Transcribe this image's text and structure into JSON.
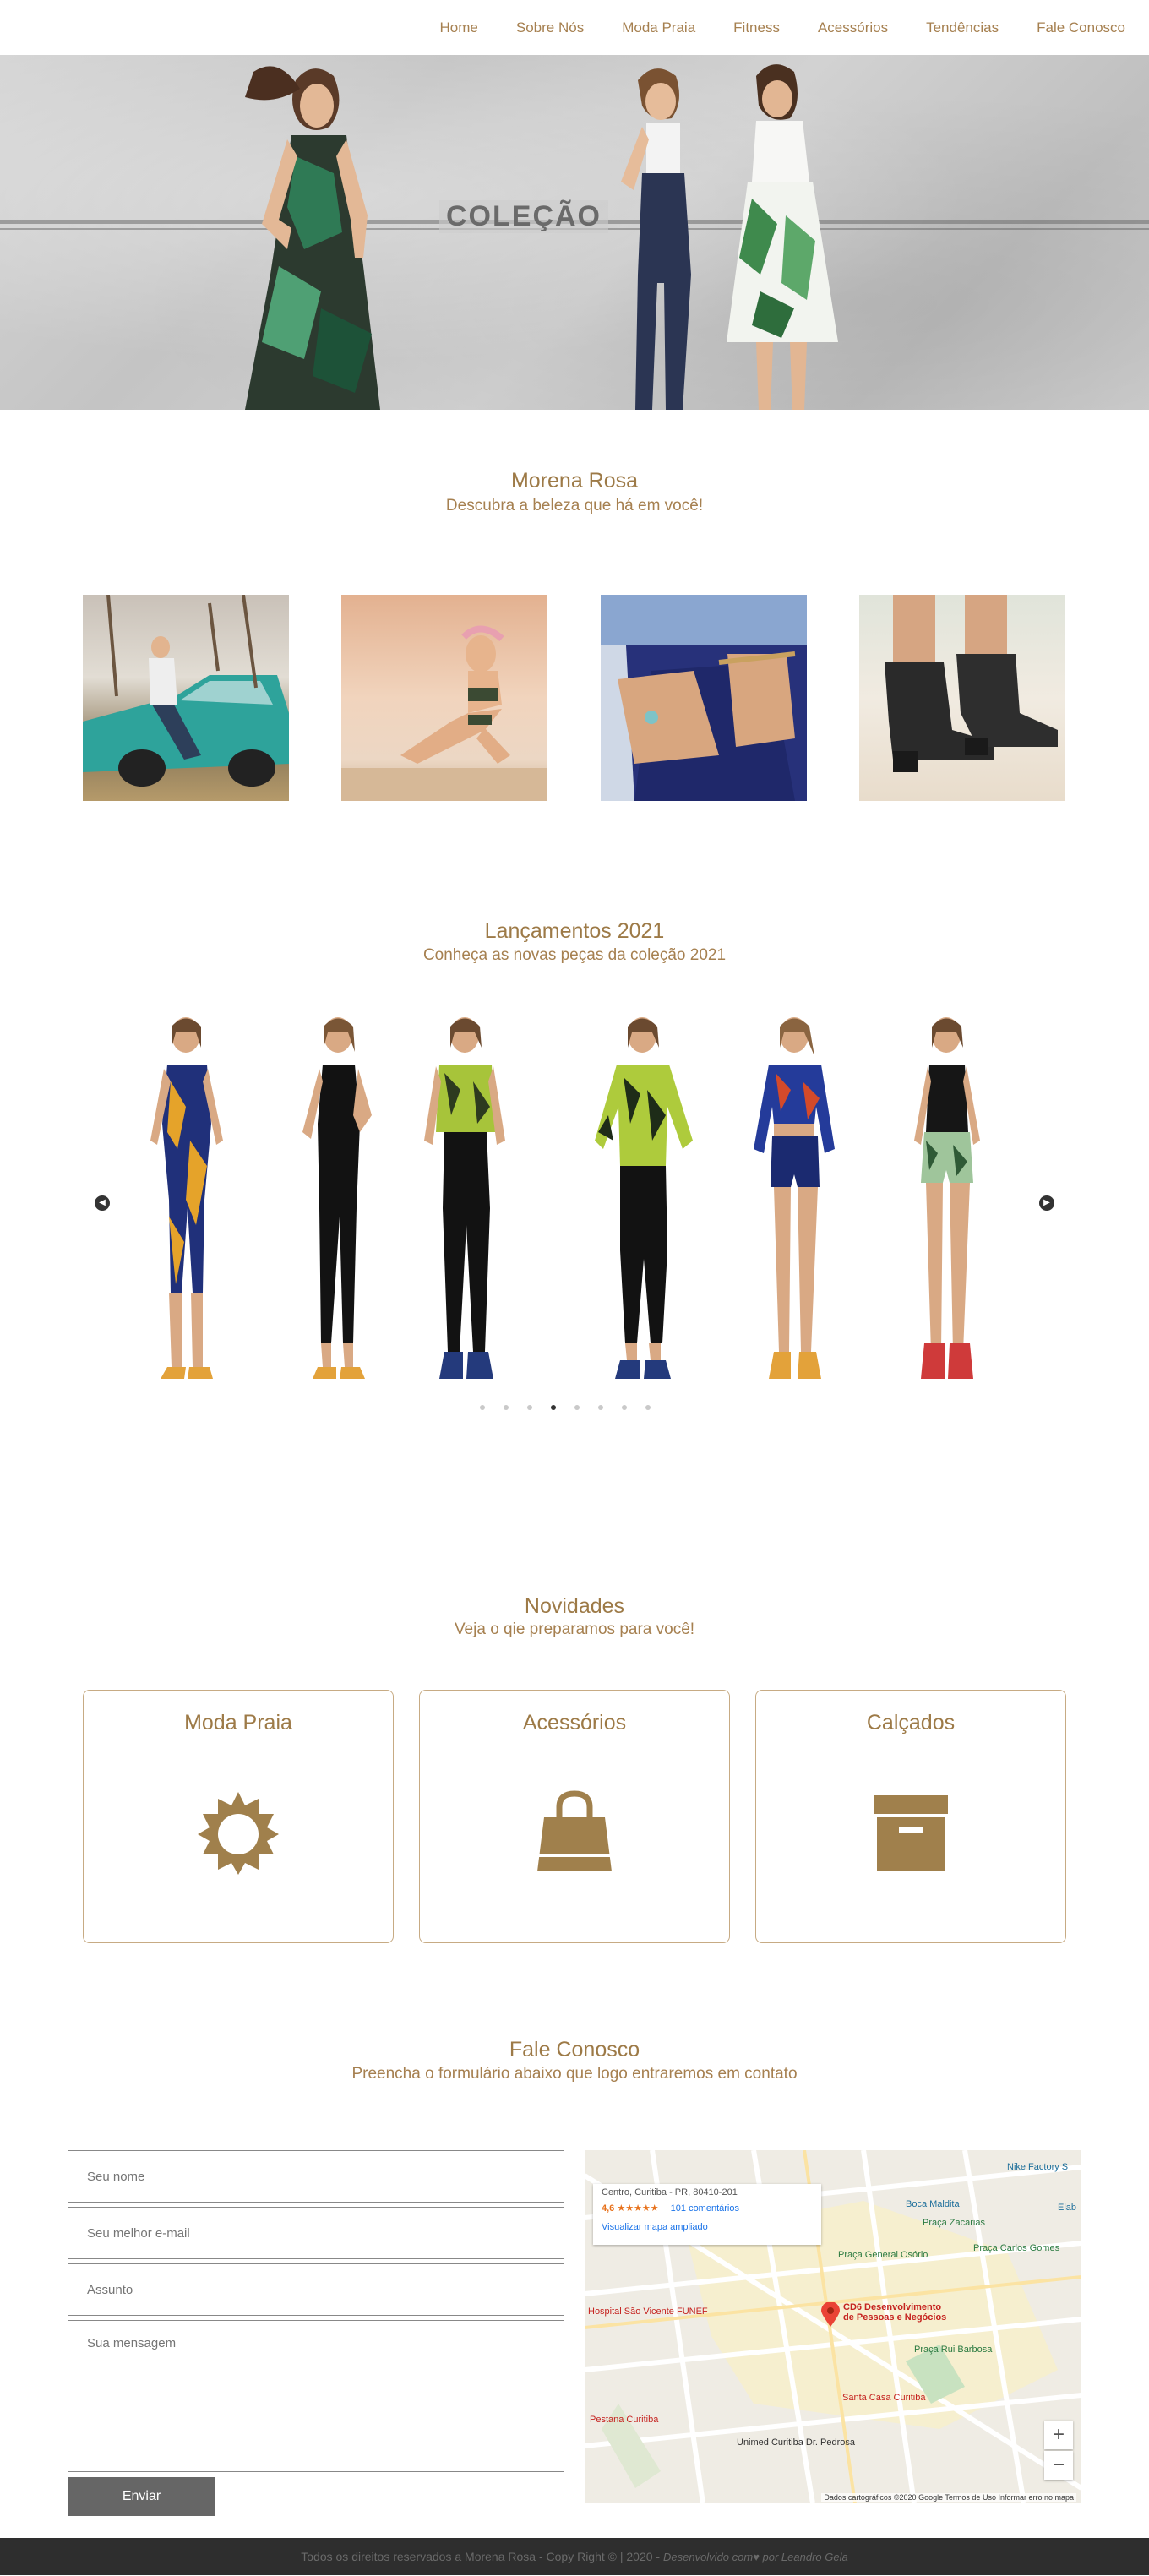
{
  "nav": [
    "Home",
    "Sobre Nós",
    "Moda Praia",
    "Fitness",
    "Acessórios",
    "Tendências",
    "Fale Conosco"
  ],
  "hero": {
    "title": "COLEÇÃO"
  },
  "intro": {
    "title": "Morena Rosa",
    "subtitle": "Descubra a beleza que há em você!"
  },
  "launches": {
    "title": "Lançamentos 2021",
    "subtitle": "Conheça as novas peças da coleção 2021",
    "prev": "◀",
    "next": "▶",
    "active_dot": 4,
    "dots": 8
  },
  "news": {
    "title": "Novidades",
    "subtitle": "Veja o qie preparamos para você!",
    "cards": [
      {
        "label": "Moda Praia",
        "icon": "sun-icon"
      },
      {
        "label": "Acessórios",
        "icon": "shopping-bag-icon"
      },
      {
        "label": "Calçados",
        "icon": "box-icon"
      }
    ]
  },
  "contact": {
    "title": "Fale Conosco",
    "subtitle": "Preencha o formulário abaixo que logo entraremos em contato",
    "name_placeholder": "Seu nome",
    "email_placeholder": "Seu melhor e-mail",
    "subject_placeholder": "Assunto",
    "message_placeholder": "Sua mensagem",
    "submit": "Enviar"
  },
  "map": {
    "address": "Centro, Curitiba - PR, 80410-201",
    "rating": "4,6 ★★★★★",
    "reviews": "101 comentários",
    "enlarge": "Visualizar mapa ampliado",
    "marker": "CD6 Desenvolvimento de Pessoas e Negócios",
    "places": [
      "Boca Maldita",
      "Praça Zacarias",
      "Praça General Osório",
      "Praça Carlos Gomes",
      "Nike Factory S",
      "Hospital São Vicente FUNEF",
      "Praça Rui Barbosa",
      "Santa Casa Curitiba",
      "Pestana Curitiba",
      "Unimed Curitiba Dr. Pedrosa",
      "Elab"
    ],
    "footer": "Dados cartográficos ©2020 Google   Termos de Uso   Informar erro no mapa"
  },
  "footer": {
    "text": "Todos os direitos reservados a Morena Rosa - Copy Right © | 2020 -",
    "dev": "Desenvolvido com♥ por Leandro Gela"
  },
  "colors": {
    "accent": "#a07f4e",
    "card_border": "#c7ab84",
    "footer_bg": "#2e2e2e"
  }
}
